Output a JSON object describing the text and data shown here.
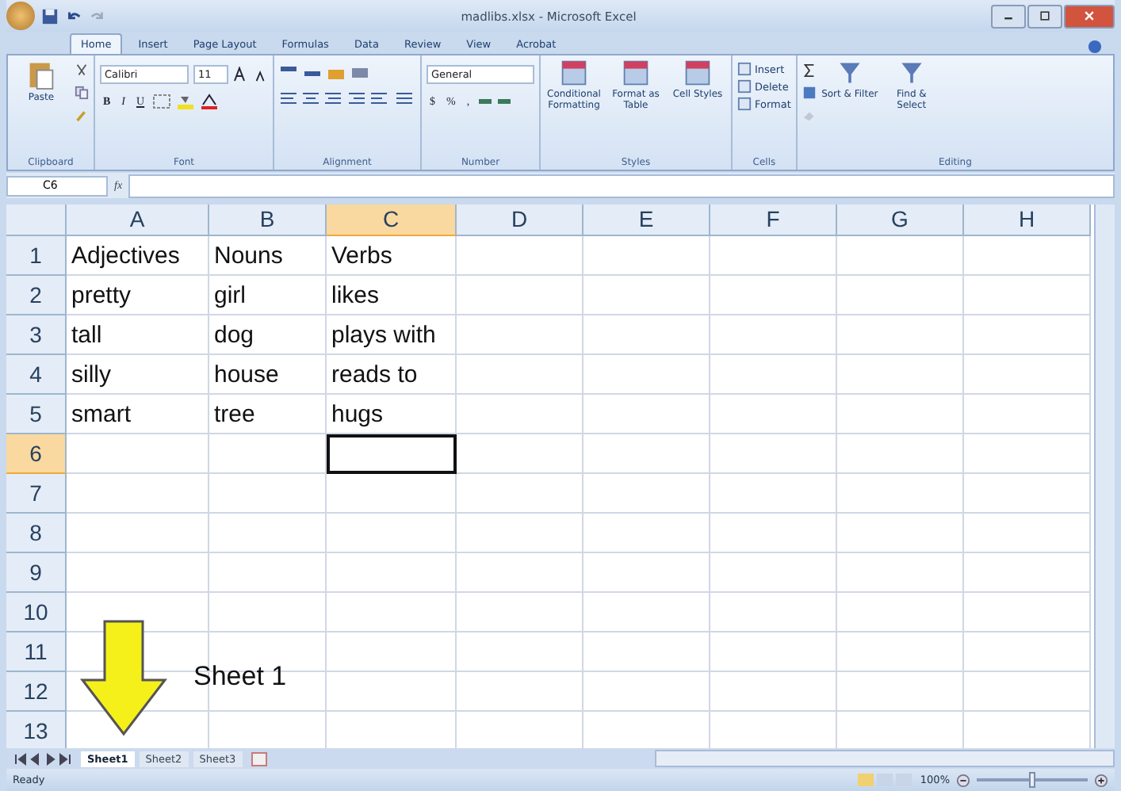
{
  "window": {
    "title": "madlibs.xlsx - Microsoft Excel"
  },
  "ribbon_tabs": [
    {
      "label": "Home",
      "selected": true
    },
    {
      "label": "Insert",
      "selected": false
    },
    {
      "label": "Page Layout",
      "selected": false
    },
    {
      "label": "Formulas",
      "selected": false
    },
    {
      "label": "Data",
      "selected": false
    },
    {
      "label": "Review",
      "selected": false
    },
    {
      "label": "View",
      "selected": false
    },
    {
      "label": "Acrobat",
      "selected": false
    }
  ],
  "ribbon": {
    "clipboard": {
      "label": "Clipboard",
      "paste": "Paste"
    },
    "font": {
      "label": "Font",
      "name": "Calibri",
      "size": "11",
      "bold": "B",
      "italic": "I",
      "underline": "U"
    },
    "alignment": {
      "label": "Alignment"
    },
    "number": {
      "label": "Number",
      "format": "General",
      "currency": "$",
      "percent": "%",
      "comma": ","
    },
    "styles": {
      "label": "Styles",
      "buttons": [
        "Conditional Formatting",
        "Format as Table",
        "Cell Styles"
      ]
    },
    "cells": {
      "label": "Cells",
      "buttons": [
        "Insert",
        "Delete",
        "Format"
      ]
    },
    "editing": {
      "label": "Editing",
      "buttons": [
        "Sort & Filter",
        "Find & Select"
      ]
    }
  },
  "formula_bar": {
    "name_box": "C6",
    "fx": "fx"
  },
  "columns": [
    {
      "label": "A",
      "selected": false
    },
    {
      "label": "B",
      "selected": false
    },
    {
      "label": "C",
      "selected": true
    },
    {
      "label": "D",
      "selected": false
    },
    {
      "label": "E",
      "selected": false
    },
    {
      "label": "F",
      "selected": false
    },
    {
      "label": "G",
      "selected": false
    },
    {
      "label": "H",
      "selected": false
    }
  ],
  "rows": [
    {
      "label": "1",
      "selected": false,
      "cells": [
        "Adjectives",
        "Nouns",
        "Verbs"
      ]
    },
    {
      "label": "2",
      "selected": false,
      "cells": [
        "pretty",
        "girl",
        "likes"
      ]
    },
    {
      "label": "3",
      "selected": false,
      "cells": [
        "tall",
        "dog",
        "plays with"
      ]
    },
    {
      "label": "4",
      "selected": false,
      "cells": [
        "silly",
        "house",
        "reads to"
      ]
    },
    {
      "label": "5",
      "selected": false,
      "cells": [
        "smart",
        "tree",
        "hugs"
      ]
    },
    {
      "label": "6",
      "selected": true,
      "cells": []
    },
    {
      "label": "7",
      "selected": false,
      "cells": []
    },
    {
      "label": "8",
      "selected": false,
      "cells": []
    },
    {
      "label": "9",
      "selected": false,
      "cells": []
    },
    {
      "label": "10",
      "selected": false,
      "cells": []
    },
    {
      "label": "11",
      "selected": false,
      "cells": []
    },
    {
      "label": "12",
      "selected": false,
      "cells": []
    },
    {
      "label": "13",
      "selected": false,
      "cells": []
    }
  ],
  "sheet_tabs": [
    {
      "label": "Sheet1",
      "selected": true
    },
    {
      "label": "Sheet2",
      "selected": false
    },
    {
      "label": "Sheet3",
      "selected": false
    }
  ],
  "annotation": {
    "label": "Sheet 1"
  },
  "status_bar": {
    "text": "Ready",
    "zoom": "100%",
    "zoom_slider": {
      "level": 0.5
    }
  }
}
